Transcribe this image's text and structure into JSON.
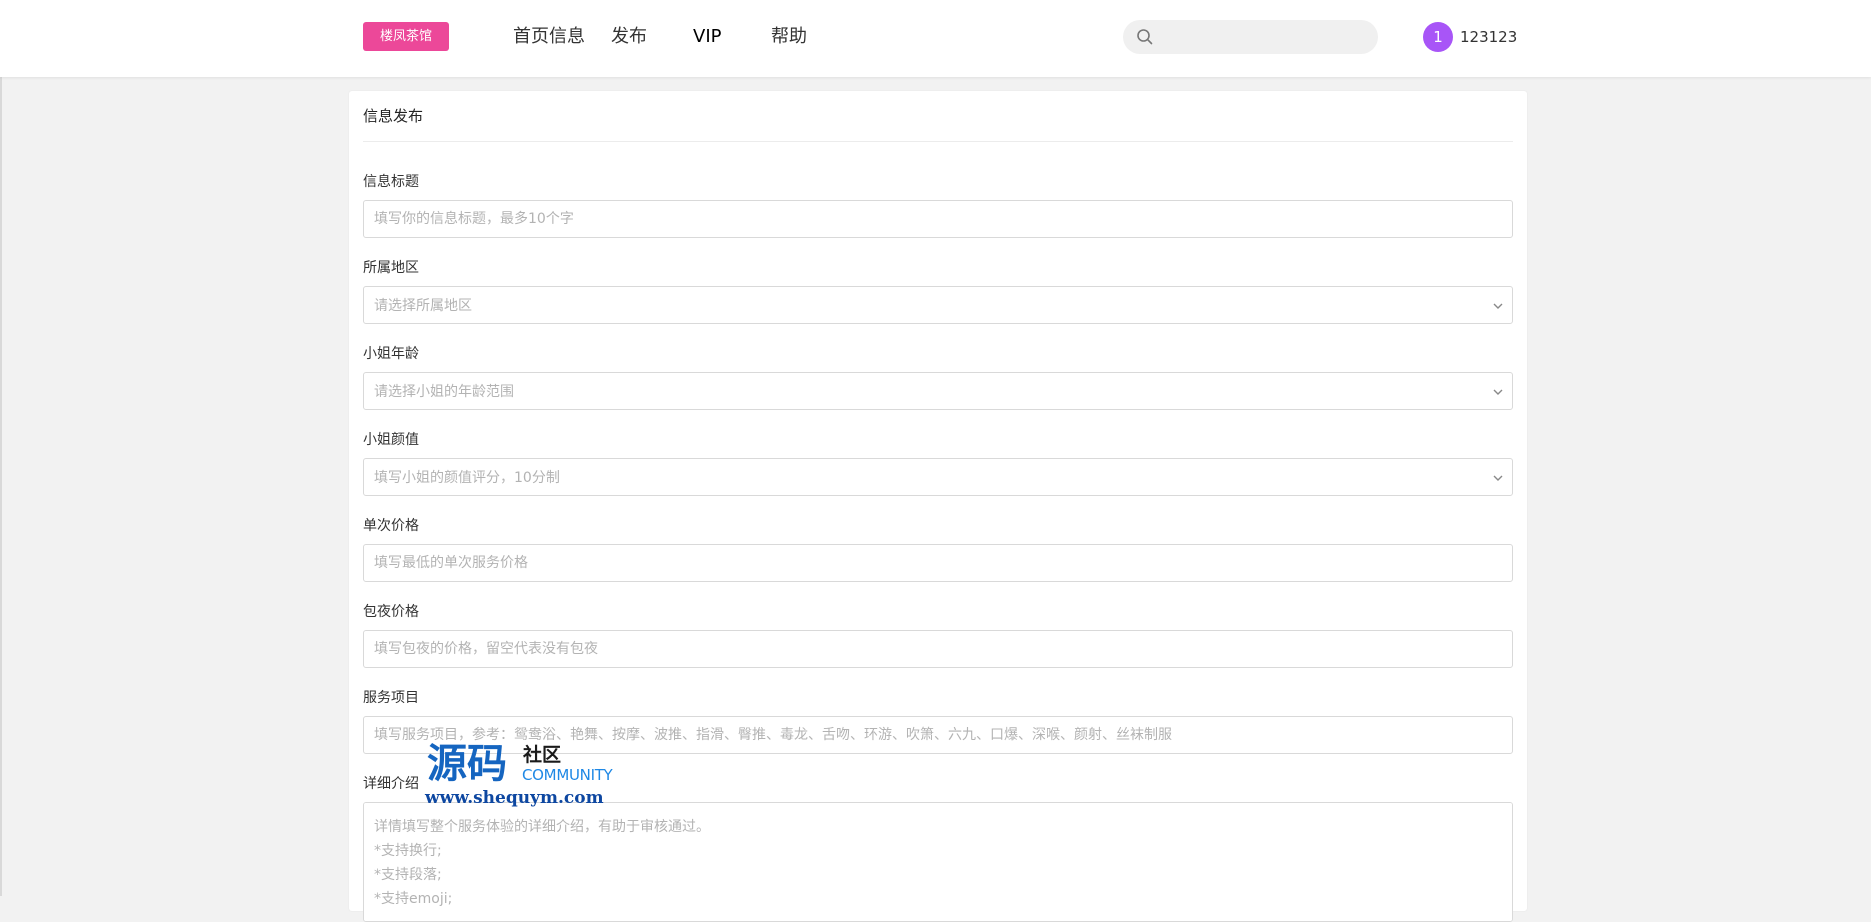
{
  "header": {
    "logo": "楼凤茶馆",
    "nav": [
      "首页信息",
      "发布",
      "VIP",
      "帮助"
    ],
    "search_placeholder": "",
    "avatar_text": "1",
    "username": "123123"
  },
  "form": {
    "title": "信息发布",
    "fields": [
      {
        "label": "信息标题",
        "placeholder": "填写你的信息标题，最多10个字"
      },
      {
        "label": "所属地区",
        "placeholder": "请选择所属地区"
      },
      {
        "label": "小姐年龄",
        "placeholder": "请选择小姐的年龄范围"
      },
      {
        "label": "小姐颜值",
        "placeholder": "填写小姐的颜值评分，10分制"
      },
      {
        "label": "单次价格",
        "placeholder": "填写最低的单次服务价格"
      },
      {
        "label": "包夜价格",
        "placeholder": "填写包夜的价格，留空代表没有包夜"
      },
      {
        "label": "服务项目",
        "placeholder": "填写服务项目，参考：鸳鸯浴、艳舞、按摩、波推、指滑、臀推、毒龙、舌吻、环游、吹箫、六九、口爆、深喉、颜射、丝袜制服"
      },
      {
        "label": "详细介绍",
        "placeholder": "详情填写整个服务体验的详细介绍，有助于审核通过。\n*支持换行;\n*支持段落;\n*支持emoji;"
      }
    ]
  },
  "watermark": {
    "big": "源码",
    "small": "社区",
    "en": "COMMUNITY",
    "url": "www.shequym.com"
  },
  "colors": {
    "brand": "#ec4899",
    "avatar": "#a855f7",
    "watermark_blue": "#1565c0"
  }
}
